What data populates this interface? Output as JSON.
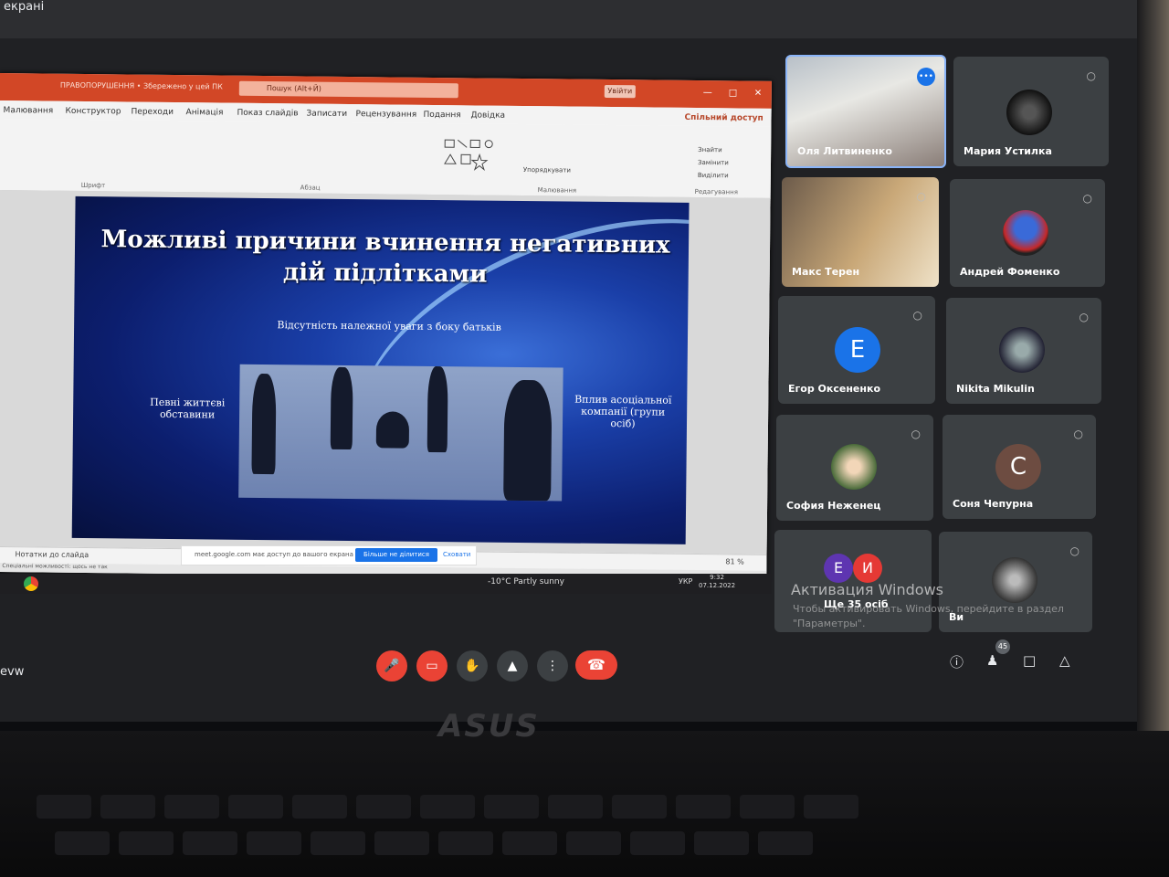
{
  "share_banner": {
    "text": "екрані"
  },
  "ppt": {
    "title": "ПРАВОПОРУШЕННЯ • Збережено у цей ПК",
    "search_placeholder": "Пошук (Alt+Й)",
    "signin": "Увійти",
    "share": "Спільний доступ",
    "tabs": [
      "Малювання",
      "Конструктор",
      "Переходи",
      "Анімація",
      "Показ слайдів",
      "Записати",
      "Рецензування",
      "Подання",
      "Довідка"
    ],
    "groups": [
      "Шрифт",
      "Абзац",
      "Малювання",
      "Редагування"
    ],
    "ribbon_buttons": [
      "Упорядкувати",
      "Знайти",
      "Замінити",
      "Виділити"
    ],
    "notes": "Нотатки до слайда",
    "status": "Спеціальні можливості: щось не так",
    "zoom": "81 %"
  },
  "slide": {
    "title": "Можливі причини вчинення негативних дій підлітками",
    "top_cause": "Відсутність належної уваги з боку батьків",
    "left_cause": "Певні життєві обставини",
    "right_cause": "Вплив асоціальної компанії (групи осіб)"
  },
  "share_popup": {
    "message": "meet.google.com має доступ до вашого екрана",
    "stop": "Більше не ділитися",
    "hide": "Сховати"
  },
  "taskbar": {
    "weather": "-10°C Partly sunny",
    "lang": "УКР",
    "time": "9:32",
    "date": "07.12.2022"
  },
  "participants": [
    {
      "name": "Оля Литвиненко",
      "type": "video",
      "speaking": true
    },
    {
      "name": "Мария Устилка",
      "type": "photo",
      "muted": true
    },
    {
      "name": "Макс Терен",
      "type": "video",
      "muted": true
    },
    {
      "name": "Андрей Фоменко",
      "type": "photo",
      "muted": true
    },
    {
      "name": "Егор Оксененко",
      "type": "letter",
      "letter": "E",
      "color": "#1a73e8",
      "muted": true
    },
    {
      "name": "Nikita Mikulin",
      "type": "photo",
      "muted": true
    },
    {
      "name": "София Неженец",
      "type": "photo",
      "muted": true
    },
    {
      "name": "Соня Чепурна",
      "type": "letter",
      "letter": "C",
      "color": "#6d4c41",
      "muted": true
    },
    {
      "name": "Ще 35 осіб",
      "type": "group",
      "letters": [
        "E",
        "И"
      ]
    },
    {
      "name": "Ви",
      "type": "photo",
      "muted": true
    }
  ],
  "watermark": {
    "title": "Активация Windows",
    "text": "Чтобы активировать Windows, перейдите в раздел \"Параметры\"."
  },
  "meeting_code": "evw",
  "people_count": "45",
  "brand": "ASUS",
  "colors": {
    "accent_red": "#ea4335",
    "meet_bg": "#202124",
    "ppt_red": "#d24726"
  }
}
